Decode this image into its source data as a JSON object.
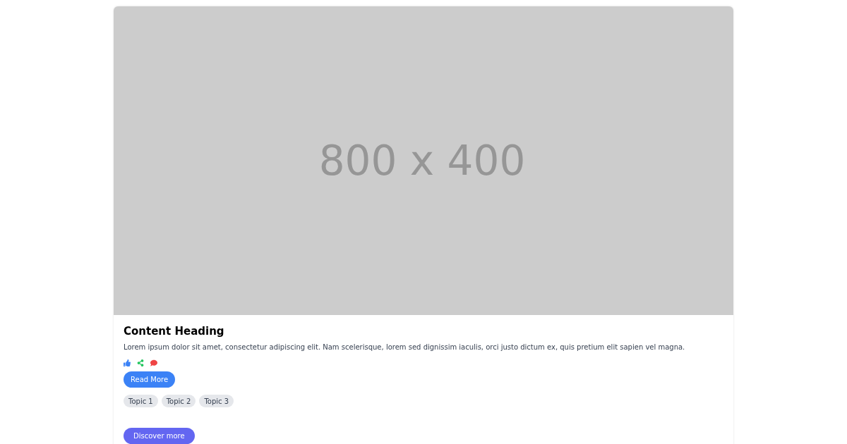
{
  "image": {
    "label": "800 x 400"
  },
  "heading": "Content Heading",
  "text": "Lorem ipsum dolor sit amet, consectetur adipiscing elit. Nam scelerisque, lorem sed dignissim iaculis, orci justo dictum ex, quis pretium elit sapien vel magna.",
  "actions": [
    {
      "kind": "like",
      "color": "#3b82f6"
    },
    {
      "kind": "share",
      "color": "#22c55e"
    },
    {
      "kind": "comment",
      "color": "#ef4444"
    }
  ],
  "read_more": "Read More",
  "topics": [
    "Topic 1",
    "Topic 2",
    "Topic 3"
  ],
  "discover": "Discover more"
}
